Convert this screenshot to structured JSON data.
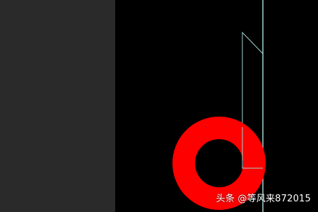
{
  "colors": {
    "side_panel": "#2a2a2a",
    "viewport_background": "#000000",
    "ring": "#ff0000",
    "wireframe": "#9fd3d0",
    "watermark_text": "#ffffff"
  },
  "scene": {
    "objects": [
      "red-ring-object",
      "wireframe-outline"
    ]
  },
  "watermark": {
    "text": "头条 @等风来872015"
  }
}
